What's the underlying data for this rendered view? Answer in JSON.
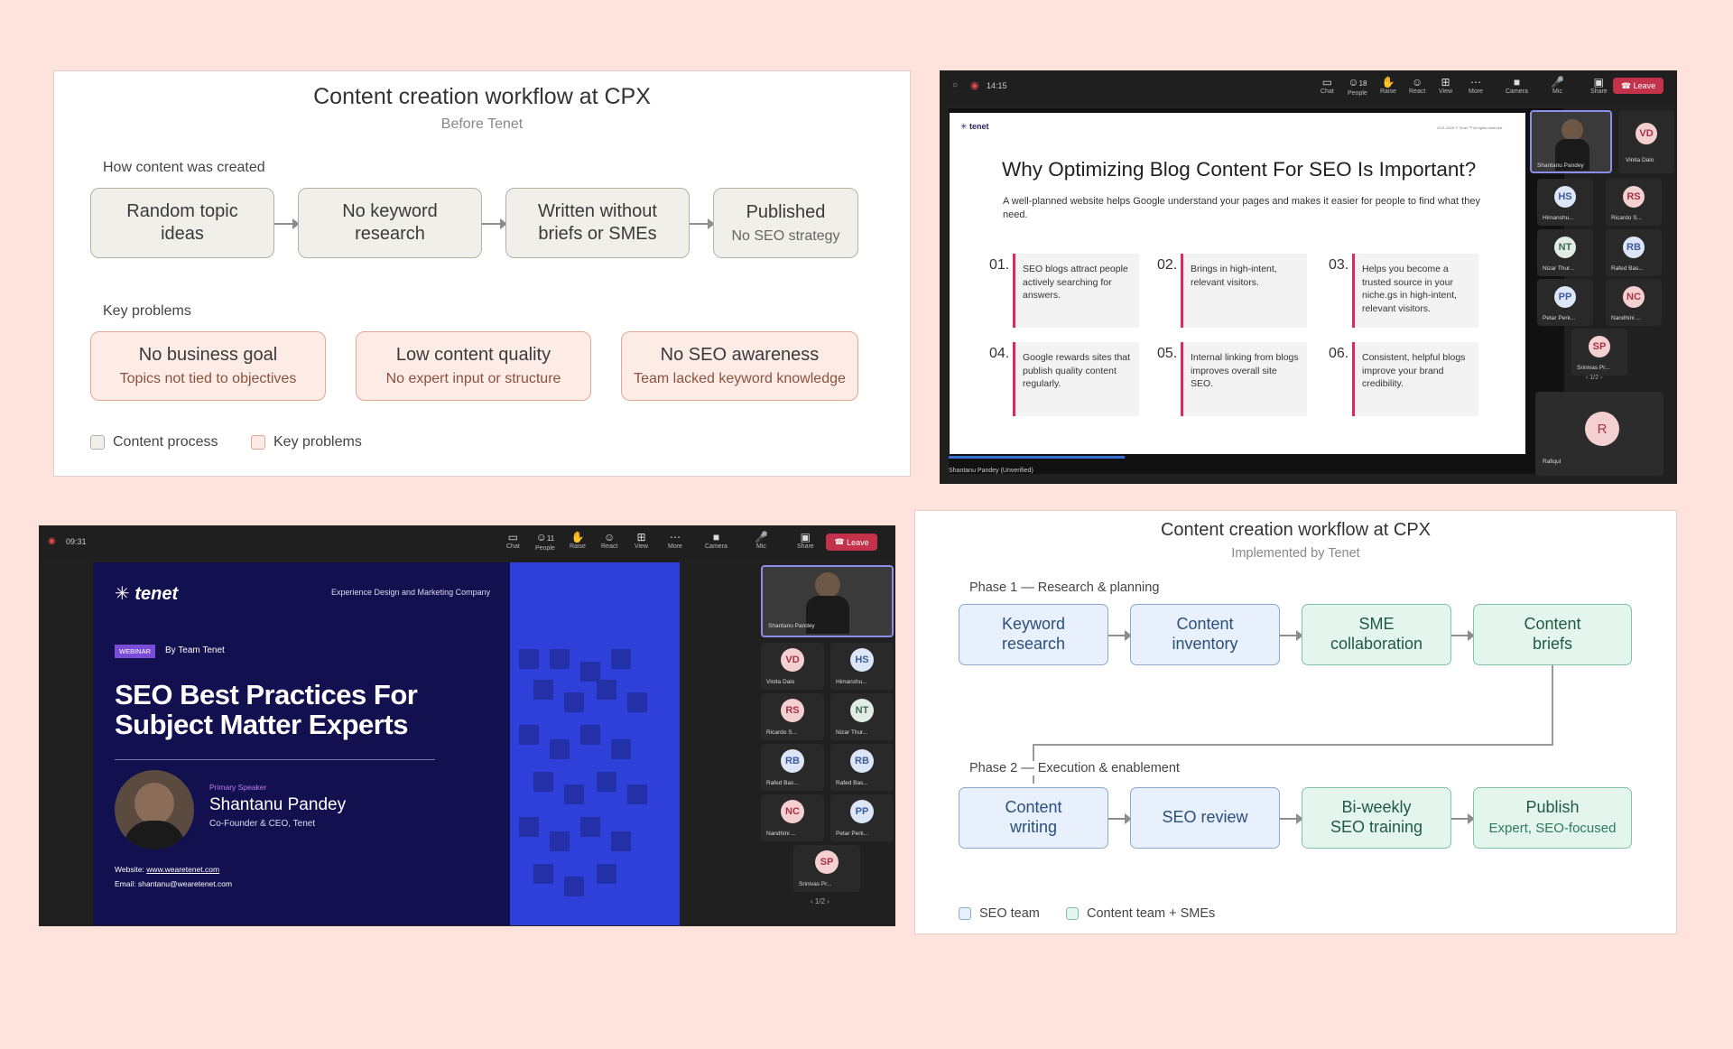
{
  "panel1": {
    "title": "Content creation workflow at CPX",
    "subtitle": "Before Tenet",
    "section1": "How content was created",
    "flow": [
      {
        "title": "Random topic ideas"
      },
      {
        "title": "No keyword research"
      },
      {
        "title": "Written without briefs or SMEs"
      },
      {
        "title": "Published",
        "sub": "No SEO strategy"
      }
    ],
    "section2": "Key problems",
    "problems": [
      {
        "title": "No business goal",
        "sub": "Topics not tied to objectives"
      },
      {
        "title": "Low content quality",
        "sub": "No expert input or structure"
      },
      {
        "title": "No SEO awareness",
        "sub": "Team lacked keyword knowledge"
      }
    ],
    "legend": [
      {
        "label": "Content process",
        "color": "#f1efe9"
      },
      {
        "label": "Key problems",
        "color": "#fdece6"
      }
    ]
  },
  "meeting1": {
    "time": "14:15",
    "toolbar": [
      {
        "label": "Chat",
        "icon": "chat-icon"
      },
      {
        "label": "People",
        "icon": "people-icon",
        "count": "18"
      },
      {
        "label": "Raise",
        "icon": "raise-hand-icon"
      },
      {
        "label": "React",
        "icon": "react-icon"
      },
      {
        "label": "View",
        "icon": "view-icon"
      },
      {
        "label": "More",
        "icon": "more-icon"
      },
      {
        "label": "Camera",
        "icon": "camera-icon"
      },
      {
        "label": "Mic",
        "icon": "mic-icon"
      },
      {
        "label": "Share",
        "icon": "share-icon"
      }
    ],
    "leave": "Leave",
    "slide": {
      "logo": "tenet",
      "copyright": "2021-2026 © Tenet ™ All rights reserved.",
      "title": "Why Optimizing Blog Content For SEO Is Important?",
      "intro": "A well-planned website helps Google understand your pages and makes it easier for people to find what they need.",
      "items": [
        {
          "num": "01.",
          "text": "SEO blogs attract people actively searching for answers."
        },
        {
          "num": "02.",
          "text": "Brings in high-intent, relevant visitors."
        },
        {
          "num": "03.",
          "text": "Helps you become a trusted source in your niche.gs in high-intent, relevant visitors."
        },
        {
          "num": "04.",
          "text": "Google rewards sites that publish quality content regularly."
        },
        {
          "num": "05.",
          "text": "Internal linking from blogs improves overall site SEO."
        },
        {
          "num": "06.",
          "text": "Consistent, helpful blogs improve your brand credibility."
        }
      ]
    },
    "presenter": "Shantanu Pandey (Unverified)",
    "speaker_tile": "Shantanu Pandey",
    "participants": [
      {
        "initials": "VD",
        "name": "Vinita Dalo"
      },
      {
        "initials": "HS",
        "name": "Himanshu..."
      },
      {
        "initials": "RS",
        "name": "Ricardo S..."
      },
      {
        "initials": "NT",
        "name": "Nizar Thur..."
      },
      {
        "initials": "RB",
        "name": "Rafed Bas..."
      },
      {
        "initials": "PP",
        "name": "Petar Perk..."
      },
      {
        "initials": "NC",
        "name": "Nandhini ..."
      },
      {
        "initials": "SP",
        "name": "Srinivas Pr..."
      }
    ],
    "page": "1/2",
    "extra": {
      "initials": "R",
      "name": "Rafiqul"
    }
  },
  "meeting2": {
    "time": "09:31",
    "toolbar": [
      {
        "label": "Chat",
        "icon": "chat-icon"
      },
      {
        "label": "People",
        "icon": "people-icon",
        "count": "11"
      },
      {
        "label": "Raise",
        "icon": "raise-hand-icon"
      },
      {
        "label": "React",
        "icon": "react-icon"
      },
      {
        "label": "View",
        "icon": "view-icon"
      },
      {
        "label": "More",
        "icon": "more-icon"
      },
      {
        "label": "Camera",
        "icon": "camera-icon"
      },
      {
        "label": "Mic",
        "icon": "mic-icon"
      },
      {
        "label": "Share",
        "icon": "share-icon"
      }
    ],
    "leave": "Leave",
    "slide": {
      "logo": "tenet",
      "tagline": "Experience Design and Marketing Company",
      "badge": "WEBINAR",
      "by": "By Team Tenet",
      "title1": "SEO Best Practices For",
      "title2": "Subject Matter Experts",
      "role": "Primary Speaker",
      "name": "Shantanu Pandey",
      "position": "Co-Founder & CEO, Tenet",
      "website_label": "Website:",
      "website": "www.wearetenet.com",
      "email": "Email: shantanu@wearetenet.com"
    },
    "speaker_tile": "Shantanu Pandey",
    "participants": [
      {
        "initials": "VD",
        "name": "Vinita Dalo"
      },
      {
        "initials": "HS",
        "name": "Himanshu..."
      },
      {
        "initials": "RS",
        "name": "Ricardo S..."
      },
      {
        "initials": "NT",
        "name": "Nizar Thur..."
      },
      {
        "initials": "RB",
        "name": "Rafed Bas..."
      },
      {
        "initials": "RB",
        "name": "Rafed Bas..."
      },
      {
        "initials": "NC",
        "name": "Nandhini ..."
      },
      {
        "initials": "PP",
        "name": "Petar Perk..."
      },
      {
        "initials": "SP",
        "name": "Srinivas Pr..."
      }
    ],
    "page": "1/2"
  },
  "panel4": {
    "title": "Content creation workflow at CPX",
    "subtitle": "Implemented by Tenet",
    "phase1": "Phase 1 — Research & planning",
    "phase1_boxes": [
      {
        "title": "Keyword research",
        "team": "seo"
      },
      {
        "title": "Content inventory",
        "team": "seo"
      },
      {
        "title": "SME collaboration",
        "team": "content"
      },
      {
        "title": "Content briefs",
        "team": "content"
      }
    ],
    "phase2": "Phase 2 — Execution & enablement",
    "phase2_boxes": [
      {
        "title": "Content writing",
        "team": "seo"
      },
      {
        "title": "SEO review",
        "team": "seo"
      },
      {
        "title": "Bi-weekly SEO training",
        "team": "content"
      },
      {
        "title": "Publish",
        "sub": "Expert, SEO-focused",
        "team": "content"
      }
    ],
    "legend": [
      {
        "label": "SEO team",
        "color": "#e8f0fb"
      },
      {
        "label": "Content team + SMEs",
        "color": "#e4f5ee"
      }
    ]
  }
}
